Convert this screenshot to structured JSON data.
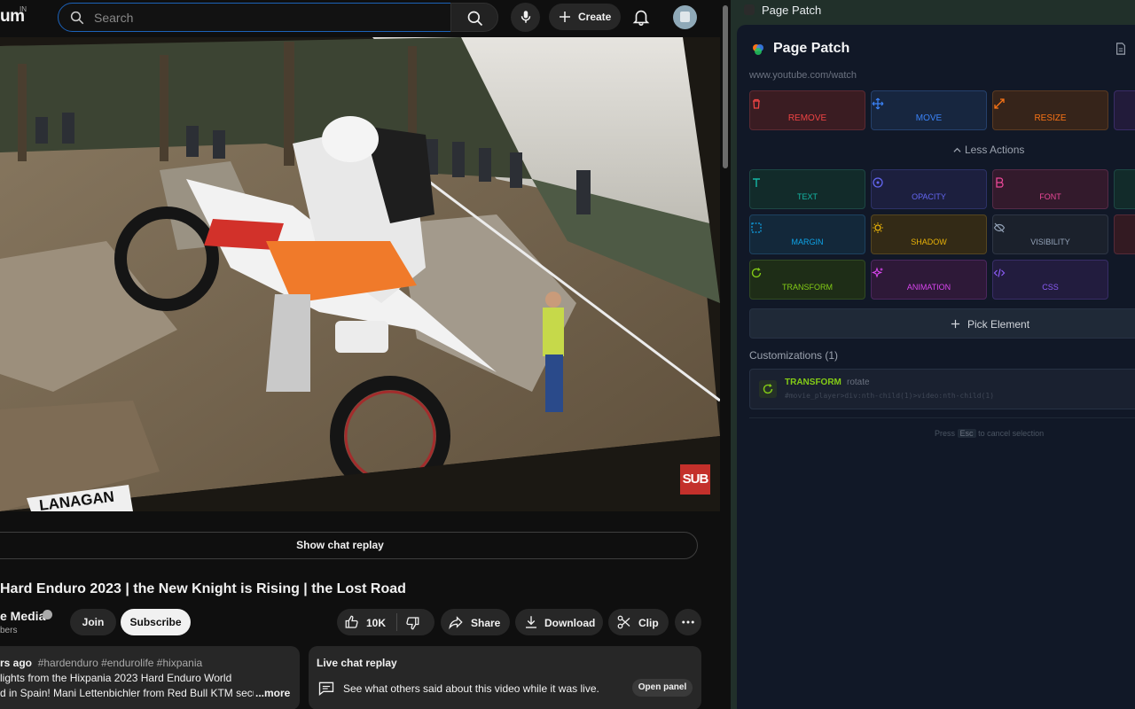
{
  "masthead": {
    "logo_fragment": "um",
    "country_code": "IN",
    "search_placeholder": "Search",
    "create_label": "Create"
  },
  "video": {
    "overlay_text": "SUB",
    "sign_text": "LANAGAN"
  },
  "chat_replay_button": "Show chat replay",
  "title": "Hard Enduro 2023 | the New Knight is Rising | the Lost Road",
  "channel": {
    "name": "e Media",
    "subscribers": "bers",
    "join_label": "Join",
    "subscribe_label": "Subscribe"
  },
  "actions": {
    "like_count": "10K",
    "share_label": "Share",
    "download_label": "Download",
    "clip_label": "Clip"
  },
  "description": {
    "time": "rs ago",
    "hashtags": "#hardenduro #endurolife #hixpania",
    "line2": "lights from the Hixpania 2023 Hard Enduro World",
    "line3": "d in Spain! Mani Lettenbichler from Red Bull KTM secur",
    "more_label": "...more"
  },
  "live_chat": {
    "heading": "Live chat replay",
    "text": "See what others said about this video while it was live.",
    "button": "Open panel"
  },
  "panel": {
    "window_title": "Page Patch",
    "title": "Page Patch",
    "url": "www.youtube.com/watch",
    "primary_actions": [
      {
        "label": "REMOVE",
        "icon": "trash-icon",
        "color": "#ef4444"
      },
      {
        "label": "MOVE",
        "icon": "move-icon",
        "color": "#3b82f6"
      },
      {
        "label": "RESIZE",
        "icon": "resize-icon",
        "color": "#f97316"
      }
    ],
    "less_actions_label": "Less Actions",
    "secondary_actions": [
      {
        "label": "TEXT",
        "icon": "text-icon",
        "color": "#14b8a6"
      },
      {
        "label": "OPACITY",
        "icon": "opacity-icon",
        "color": "#6366f1"
      },
      {
        "label": "FONT",
        "icon": "font-icon",
        "color": "#ec4899"
      },
      {
        "label": "MARGIN",
        "icon": "margin-icon",
        "color": "#0ea5e9"
      },
      {
        "label": "SHADOW",
        "icon": "shadow-icon",
        "color": "#eab308"
      },
      {
        "label": "VISIBILITY",
        "icon": "visibility-icon",
        "color": "#94a3b8"
      },
      {
        "label": "TRANSFORM",
        "icon": "transform-icon",
        "color": "#84cc16"
      },
      {
        "label": "ANIMATION",
        "icon": "animation-icon",
        "color": "#d946ef"
      },
      {
        "label": "CSS",
        "icon": "css-icon",
        "color": "#8b5cf6"
      }
    ],
    "pick_element_label": "Pick Element",
    "customizations_heading": "Customizations (1)",
    "customization": {
      "type": "TRANSFORM",
      "property": "rotate",
      "selector": "#movie_player>div:nth-child(1)>video:nth-child(1)"
    },
    "hint_before": "Press",
    "hint_key": "Esc",
    "hint_after": "to cancel selection"
  }
}
